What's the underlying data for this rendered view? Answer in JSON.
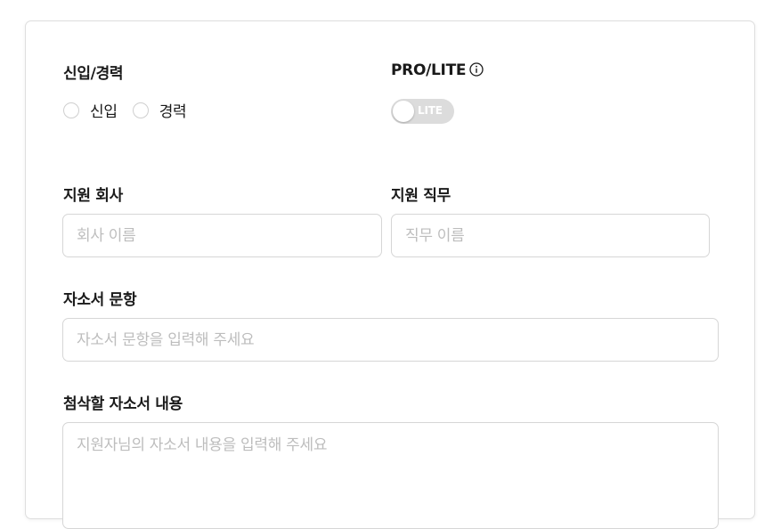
{
  "career": {
    "label": "신입/경력",
    "options": [
      "신입",
      "경력"
    ]
  },
  "plan": {
    "label": "PRO/LITE",
    "info_icon": "info-circle-icon",
    "toggle_text": "LITE"
  },
  "company": {
    "label": "지원 회사",
    "placeholder": "회사 이름"
  },
  "position": {
    "label": "지원 직무",
    "placeholder": "직무 이름"
  },
  "question": {
    "label": "자소서 문항",
    "placeholder": "자소서 문항을 입력해 주세요"
  },
  "content": {
    "label": "첨삭할 자소서 내용",
    "placeholder": "지원자님의 자소서 내용을 입력해 주세요"
  }
}
